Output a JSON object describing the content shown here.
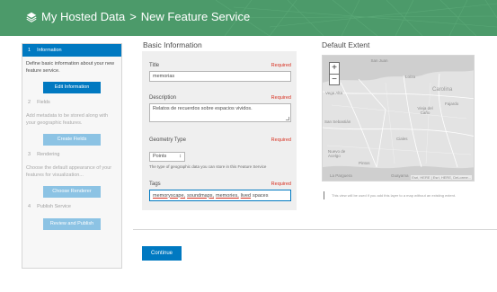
{
  "header": {
    "crumb_root": "My Hosted Data",
    "separator": ">",
    "crumb_current": "New Feature Service"
  },
  "steps": [
    {
      "num": "1",
      "title": "Information",
      "desc": "Define basic information about your new feature service.",
      "button": "Edit Information",
      "active": true
    },
    {
      "num": "2",
      "title": "Fields",
      "desc": "Add metadata to be stored along with your geographic features.",
      "button": "Create Fields",
      "active": false
    },
    {
      "num": "3",
      "title": "Rendering",
      "desc": "Choose the default appearance of your features for visualization...",
      "button": "Choose Renderer",
      "active": false
    },
    {
      "num": "4",
      "title": "Publish Service",
      "desc": "",
      "button": "Review and Publish",
      "active": false
    }
  ],
  "form": {
    "section_title": "Basic Information",
    "required_label": "Required",
    "title_label": "Title",
    "title_value": "memorias",
    "description_label": "Description",
    "description_value": "Relatos de recuerdos sobre espacios vividos.",
    "geometry_label": "Geometry Type",
    "geometry_value": "Points",
    "geometry_caret": "↕",
    "geometry_hint": "The type of geographic data you can store in this Feature Service",
    "tags_label": "Tags",
    "tags": [
      "memoryscape,",
      "soundmaps,",
      "memories,",
      "lived"
    ],
    "tags_tail": "spaces"
  },
  "extent": {
    "section_title": "Default Extent",
    "zoom_in": "+",
    "zoom_out": "−",
    "labels": {
      "san_juan": "San Juan",
      "loiza": "Loíza",
      "vega_alta": "Vega Alta",
      "carolina": "Carolina",
      "vieja_del_cano": "Vieja del Caño",
      "fajardo": "Fajardo",
      "san_sebastian": "San Sebastián",
      "ciales": "Ciales",
      "nuevo_de_acelgo": "Nuevo de Acelgo",
      "pintos": "Pintos",
      "guayama": "Guayama",
      "la_parguera": "La Parguera"
    },
    "attribution": "Esri, HERE | Esri, HERE, DeLorme...",
    "note": "This view will be used if you add this layer to a map without an existing extent."
  },
  "actions": {
    "continue_label": "Continue"
  },
  "colors": {
    "header": "#4c9a6a",
    "primary": "#0079c1",
    "required": "#d83020"
  }
}
